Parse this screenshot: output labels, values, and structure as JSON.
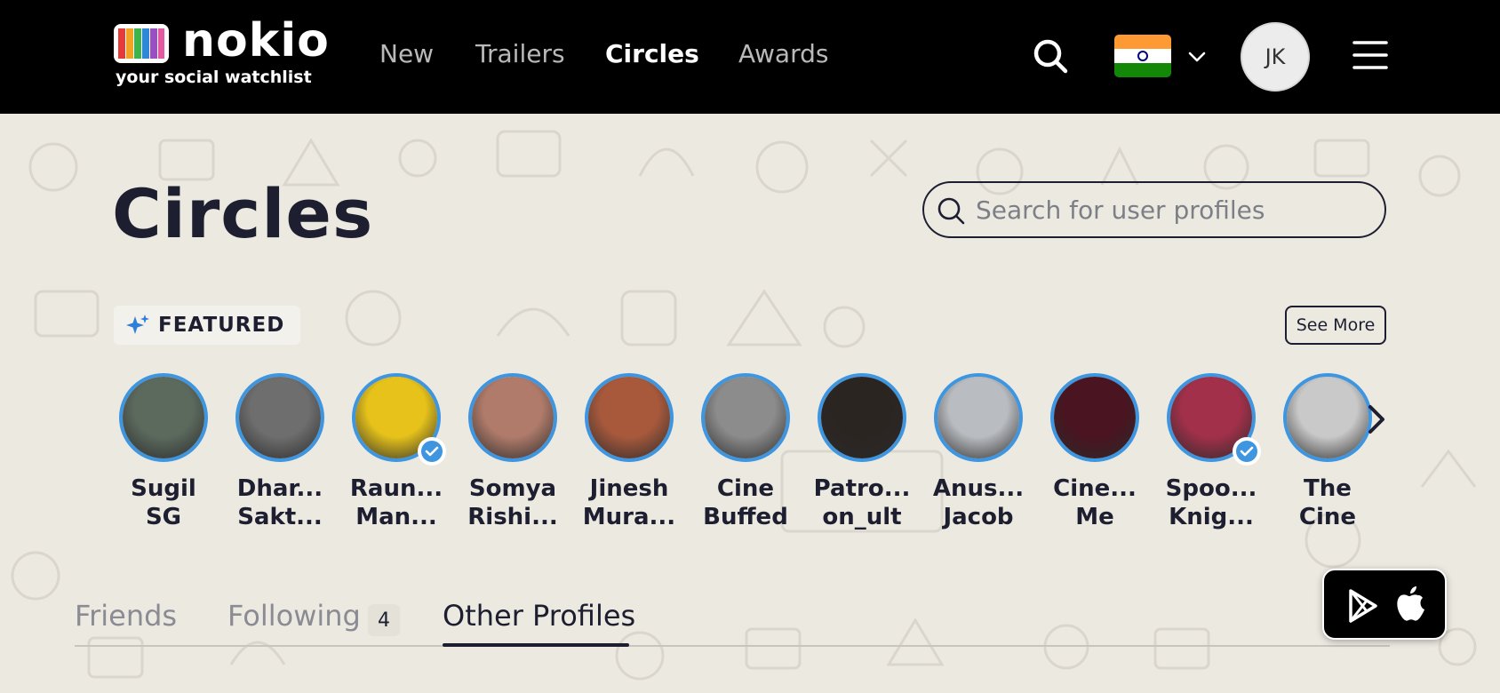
{
  "header": {
    "logo_name": "nokio",
    "logo_tagline": "your social watchlist",
    "nav": [
      {
        "label": "New"
      },
      {
        "label": "Trailers"
      },
      {
        "label": "Circles"
      },
      {
        "label": "Awards"
      }
    ],
    "active_nav": "Circles",
    "country_flag": "india-flag-icon",
    "user_initials": "JK"
  },
  "main": {
    "title": "Circles",
    "search_placeholder": "Search for user profiles",
    "featured_label": "FEATURED",
    "see_more_label": "See More",
    "profiles": [
      {
        "line1": "Sugil",
        "line2": "SG",
        "verified": false,
        "color": "#5c6a5e"
      },
      {
        "line1": "Dhar...",
        "line2": "Sakt...",
        "verified": false,
        "color": "#6e6e6e"
      },
      {
        "line1": "Raun...",
        "line2": "Man...",
        "verified": true,
        "color": "#e6c21a"
      },
      {
        "line1": "Somya",
        "line2": "Rishi...",
        "verified": false,
        "color": "#b07b6a"
      },
      {
        "line1": "Jinesh",
        "line2": "Mura...",
        "verified": false,
        "color": "#a8593c"
      },
      {
        "line1": "Cine",
        "line2": "Buffed",
        "verified": false,
        "color": "#8c8c8c"
      },
      {
        "line1": "Patro...",
        "line2": "on_ult",
        "verified": false,
        "color": "#2b2522"
      },
      {
        "line1": "Anus...",
        "line2": "Jacob",
        "verified": false,
        "color": "#b9bcc0"
      },
      {
        "line1": "Cine...",
        "line2": "Me",
        "verified": false,
        "color": "#4a1420"
      },
      {
        "line1": "Spoo...",
        "line2": "Knig...",
        "verified": true,
        "color": "#a2304a"
      },
      {
        "line1": "The",
        "line2": "Cine",
        "verified": false,
        "color": "#c9c9c9"
      }
    ]
  },
  "tabs": [
    {
      "label": "Friends"
    },
    {
      "label": "Following",
      "count": "4"
    },
    {
      "label": "Other Profiles"
    }
  ],
  "active_tab": "Other Profiles",
  "colors": {
    "accent_blue": "#3e95e0",
    "text_dark": "#1d1e30",
    "background": "#ece9e1"
  }
}
